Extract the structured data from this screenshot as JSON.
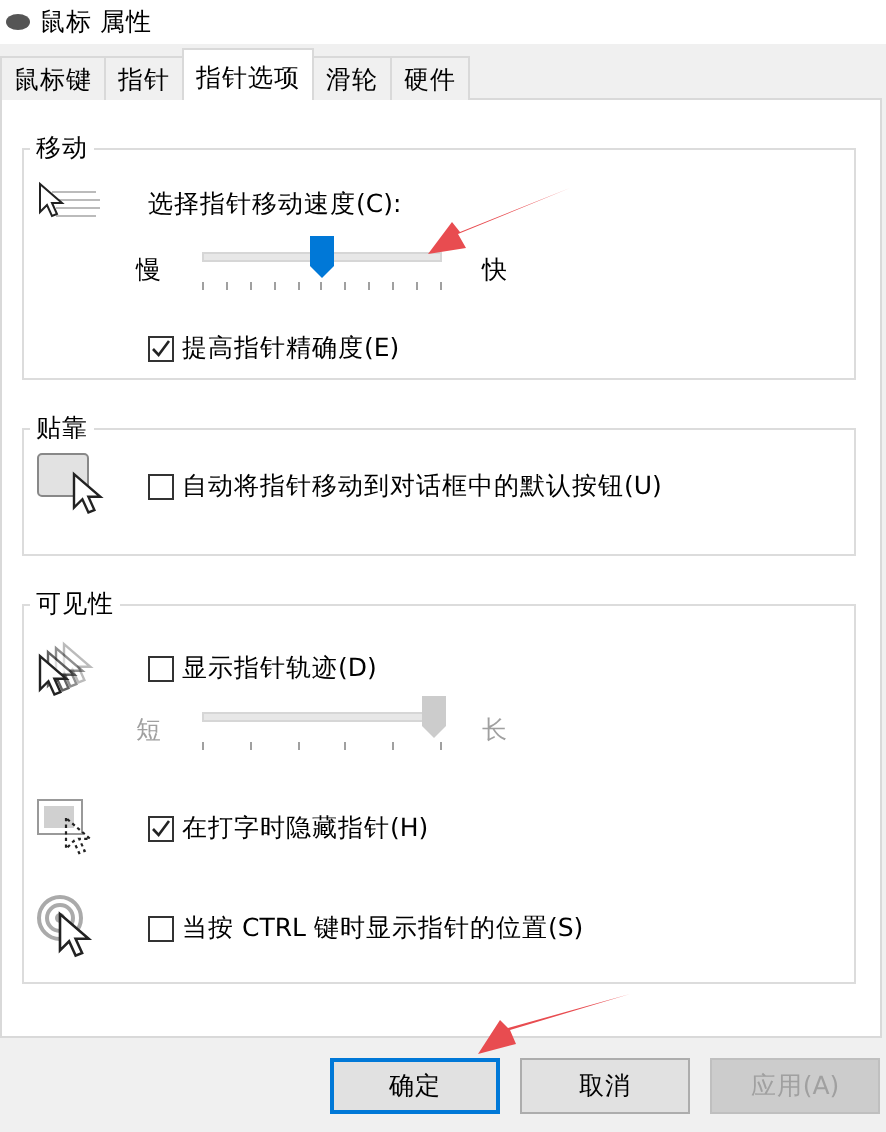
{
  "window": {
    "title": "鼠标 属性"
  },
  "tabs": [
    {
      "label": "鼠标键",
      "selected": false
    },
    {
      "label": "指针",
      "selected": false
    },
    {
      "label": "指针选项",
      "selected": true
    },
    {
      "label": "滑轮",
      "selected": false
    },
    {
      "label": "硬件",
      "selected": false
    }
  ],
  "sections": [
    {
      "title": "移动",
      "rows": [
        {
          "kind": "label",
          "text": "选择指针移动速度(C):"
        },
        {
          "kind": "slider",
          "min_label": "慢",
          "max_label": "快",
          "level": 0.5,
          "disabled": false
        },
        {
          "kind": "checkbox",
          "label": "提高指针精确度(E)",
          "checked": true
        }
      ]
    },
    {
      "title": "贴靠",
      "rows": [
        {
          "kind": "checkbox",
          "label": "自动将指针移动到对话框中的默认按钮(U)",
          "checked": false
        }
      ]
    },
    {
      "title": "可见性",
      "rows": [
        {
          "kind": "checkbox",
          "label": "显示指针轨迹(D)",
          "checked": false
        },
        {
          "kind": "slider",
          "min_label": "短",
          "max_label": "长",
          "level": 1,
          "disabled": true
        },
        {
          "kind": "checkbox",
          "label": "在打字时隐藏指针(H)",
          "checked": true
        },
        {
          "kind": "checkbox",
          "label": "当按 CTRL 键时显示指针的位置(S)",
          "checked": false
        }
      ]
    }
  ],
  "buttons": [
    {
      "label": "确定",
      "default": true,
      "disabled": false
    },
    {
      "label": "取消",
      "default": false,
      "disabled": false
    },
    {
      "label": "应用(A)",
      "default": false,
      "disabled": true
    }
  ]
}
